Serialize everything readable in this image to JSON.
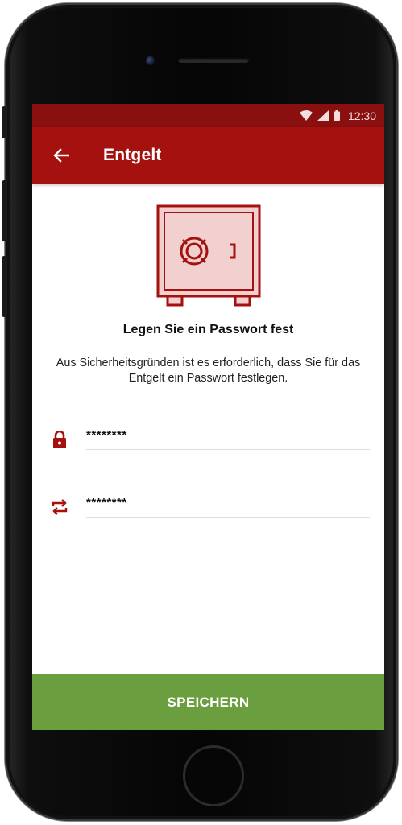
{
  "status_bar": {
    "time": "12:30",
    "icons": [
      "wifi-icon",
      "signal-icon",
      "battery-icon"
    ]
  },
  "app_bar": {
    "title": "Entgelt",
    "back_icon": "arrow-left-icon"
  },
  "content": {
    "illustration": "safe-icon",
    "heading": "Legen Sie ein Passwort fest",
    "description": "Aus Sicherheitsgründen ist es erforderlich, dass Sie für das Entgelt ein Passwort festlegen."
  },
  "form": {
    "password": {
      "icon": "lock-icon",
      "value": "********"
    },
    "repeat_password": {
      "icon": "repeat-icon",
      "value": "********"
    }
  },
  "save_button": {
    "label": "SPEICHERN"
  },
  "colors": {
    "status_bar": "#8a0f0f",
    "app_bar": "#a4110f",
    "accent": "#a4110f",
    "save_button": "#6b9e3e",
    "safe_fill": "#f2d0d0"
  }
}
